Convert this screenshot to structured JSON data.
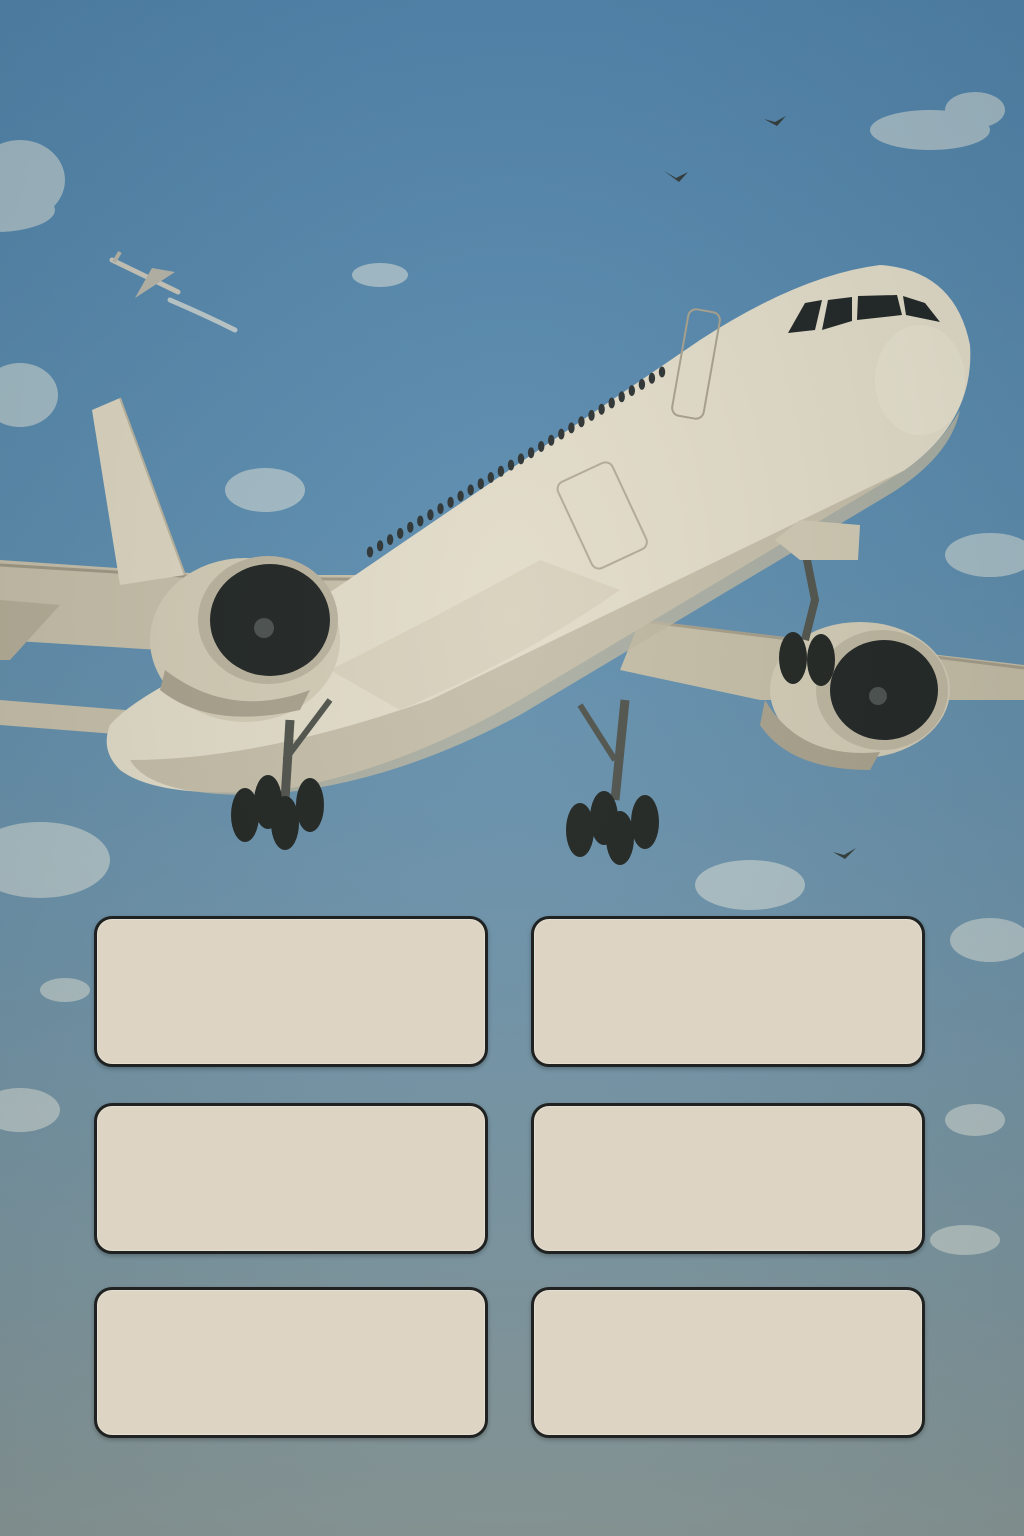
{
  "buttons": [
    {
      "label": ""
    },
    {
      "label": ""
    },
    {
      "label": ""
    },
    {
      "label": ""
    },
    {
      "label": ""
    },
    {
      "label": ""
    }
  ],
  "scene": {
    "sky_color": "#5a8cb1",
    "aircraft_color": "#e2dccb",
    "button_fill": "#ddd4c3",
    "button_border": "#1f2220"
  }
}
